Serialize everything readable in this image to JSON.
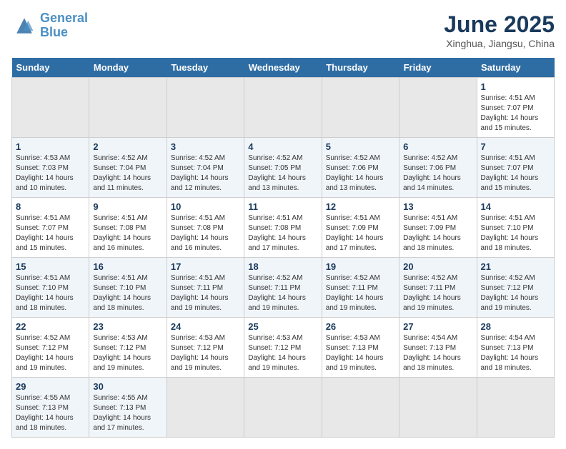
{
  "header": {
    "logo_line1": "General",
    "logo_line2": "Blue",
    "month_title": "June 2025",
    "location": "Xinghua, Jiangsu, China"
  },
  "calendar": {
    "days_of_week": [
      "Sunday",
      "Monday",
      "Tuesday",
      "Wednesday",
      "Thursday",
      "Friday",
      "Saturday"
    ],
    "weeks": [
      [
        {
          "day": "",
          "empty": true
        },
        {
          "day": "",
          "empty": true
        },
        {
          "day": "",
          "empty": true
        },
        {
          "day": "",
          "empty": true
        },
        {
          "day": "",
          "empty": true
        },
        {
          "day": "",
          "empty": true
        },
        {
          "day": "1",
          "sunrise": "Sunrise: 4:51 AM",
          "sunset": "Sunset: 7:07 PM",
          "daylight": "Daylight: 14 hours and 15 minutes."
        }
      ],
      [
        {
          "day": "1",
          "sunrise": "Sunrise: 4:53 AM",
          "sunset": "Sunset: 7:03 PM",
          "daylight": "Daylight: 14 hours and 10 minutes."
        },
        {
          "day": "2",
          "sunrise": "Sunrise: 4:52 AM",
          "sunset": "Sunset: 7:04 PM",
          "daylight": "Daylight: 14 hours and 11 minutes."
        },
        {
          "day": "3",
          "sunrise": "Sunrise: 4:52 AM",
          "sunset": "Sunset: 7:04 PM",
          "daylight": "Daylight: 14 hours and 12 minutes."
        },
        {
          "day": "4",
          "sunrise": "Sunrise: 4:52 AM",
          "sunset": "Sunset: 7:05 PM",
          "daylight": "Daylight: 14 hours and 13 minutes."
        },
        {
          "day": "5",
          "sunrise": "Sunrise: 4:52 AM",
          "sunset": "Sunset: 7:06 PM",
          "daylight": "Daylight: 14 hours and 13 minutes."
        },
        {
          "day": "6",
          "sunrise": "Sunrise: 4:52 AM",
          "sunset": "Sunset: 7:06 PM",
          "daylight": "Daylight: 14 hours and 14 minutes."
        },
        {
          "day": "7",
          "sunrise": "Sunrise: 4:51 AM",
          "sunset": "Sunset: 7:07 PM",
          "daylight": "Daylight: 14 hours and 15 minutes."
        }
      ],
      [
        {
          "day": "8",
          "sunrise": "Sunrise: 4:51 AM",
          "sunset": "Sunset: 7:07 PM",
          "daylight": "Daylight: 14 hours and 15 minutes."
        },
        {
          "day": "9",
          "sunrise": "Sunrise: 4:51 AM",
          "sunset": "Sunset: 7:08 PM",
          "daylight": "Daylight: 14 hours and 16 minutes."
        },
        {
          "day": "10",
          "sunrise": "Sunrise: 4:51 AM",
          "sunset": "Sunset: 7:08 PM",
          "daylight": "Daylight: 14 hours and 16 minutes."
        },
        {
          "day": "11",
          "sunrise": "Sunrise: 4:51 AM",
          "sunset": "Sunset: 7:08 PM",
          "daylight": "Daylight: 14 hours and 17 minutes."
        },
        {
          "day": "12",
          "sunrise": "Sunrise: 4:51 AM",
          "sunset": "Sunset: 7:09 PM",
          "daylight": "Daylight: 14 hours and 17 minutes."
        },
        {
          "day": "13",
          "sunrise": "Sunrise: 4:51 AM",
          "sunset": "Sunset: 7:09 PM",
          "daylight": "Daylight: 14 hours and 18 minutes."
        },
        {
          "day": "14",
          "sunrise": "Sunrise: 4:51 AM",
          "sunset": "Sunset: 7:10 PM",
          "daylight": "Daylight: 14 hours and 18 minutes."
        }
      ],
      [
        {
          "day": "15",
          "sunrise": "Sunrise: 4:51 AM",
          "sunset": "Sunset: 7:10 PM",
          "daylight": "Daylight: 14 hours and 18 minutes."
        },
        {
          "day": "16",
          "sunrise": "Sunrise: 4:51 AM",
          "sunset": "Sunset: 7:10 PM",
          "daylight": "Daylight: 14 hours and 18 minutes."
        },
        {
          "day": "17",
          "sunrise": "Sunrise: 4:51 AM",
          "sunset": "Sunset: 7:11 PM",
          "daylight": "Daylight: 14 hours and 19 minutes."
        },
        {
          "day": "18",
          "sunrise": "Sunrise: 4:52 AM",
          "sunset": "Sunset: 7:11 PM",
          "daylight": "Daylight: 14 hours and 19 minutes."
        },
        {
          "day": "19",
          "sunrise": "Sunrise: 4:52 AM",
          "sunset": "Sunset: 7:11 PM",
          "daylight": "Daylight: 14 hours and 19 minutes."
        },
        {
          "day": "20",
          "sunrise": "Sunrise: 4:52 AM",
          "sunset": "Sunset: 7:11 PM",
          "daylight": "Daylight: 14 hours and 19 minutes."
        },
        {
          "day": "21",
          "sunrise": "Sunrise: 4:52 AM",
          "sunset": "Sunset: 7:12 PM",
          "daylight": "Daylight: 14 hours and 19 minutes."
        }
      ],
      [
        {
          "day": "22",
          "sunrise": "Sunrise: 4:52 AM",
          "sunset": "Sunset: 7:12 PM",
          "daylight": "Daylight: 14 hours and 19 minutes."
        },
        {
          "day": "23",
          "sunrise": "Sunrise: 4:53 AM",
          "sunset": "Sunset: 7:12 PM",
          "daylight": "Daylight: 14 hours and 19 minutes."
        },
        {
          "day": "24",
          "sunrise": "Sunrise: 4:53 AM",
          "sunset": "Sunset: 7:12 PM",
          "daylight": "Daylight: 14 hours and 19 minutes."
        },
        {
          "day": "25",
          "sunrise": "Sunrise: 4:53 AM",
          "sunset": "Sunset: 7:12 PM",
          "daylight": "Daylight: 14 hours and 19 minutes."
        },
        {
          "day": "26",
          "sunrise": "Sunrise: 4:53 AM",
          "sunset": "Sunset: 7:13 PM",
          "daylight": "Daylight: 14 hours and 19 minutes."
        },
        {
          "day": "27",
          "sunrise": "Sunrise: 4:54 AM",
          "sunset": "Sunset: 7:13 PM",
          "daylight": "Daylight: 14 hours and 18 minutes."
        },
        {
          "day": "28",
          "sunrise": "Sunrise: 4:54 AM",
          "sunset": "Sunset: 7:13 PM",
          "daylight": "Daylight: 14 hours and 18 minutes."
        }
      ],
      [
        {
          "day": "29",
          "sunrise": "Sunrise: 4:55 AM",
          "sunset": "Sunset: 7:13 PM",
          "daylight": "Daylight: 14 hours and 18 minutes."
        },
        {
          "day": "30",
          "sunrise": "Sunrise: 4:55 AM",
          "sunset": "Sunset: 7:13 PM",
          "daylight": "Daylight: 14 hours and 17 minutes."
        },
        {
          "day": "",
          "empty": true
        },
        {
          "day": "",
          "empty": true
        },
        {
          "day": "",
          "empty": true
        },
        {
          "day": "",
          "empty": true
        },
        {
          "day": "",
          "empty": true
        }
      ]
    ]
  }
}
